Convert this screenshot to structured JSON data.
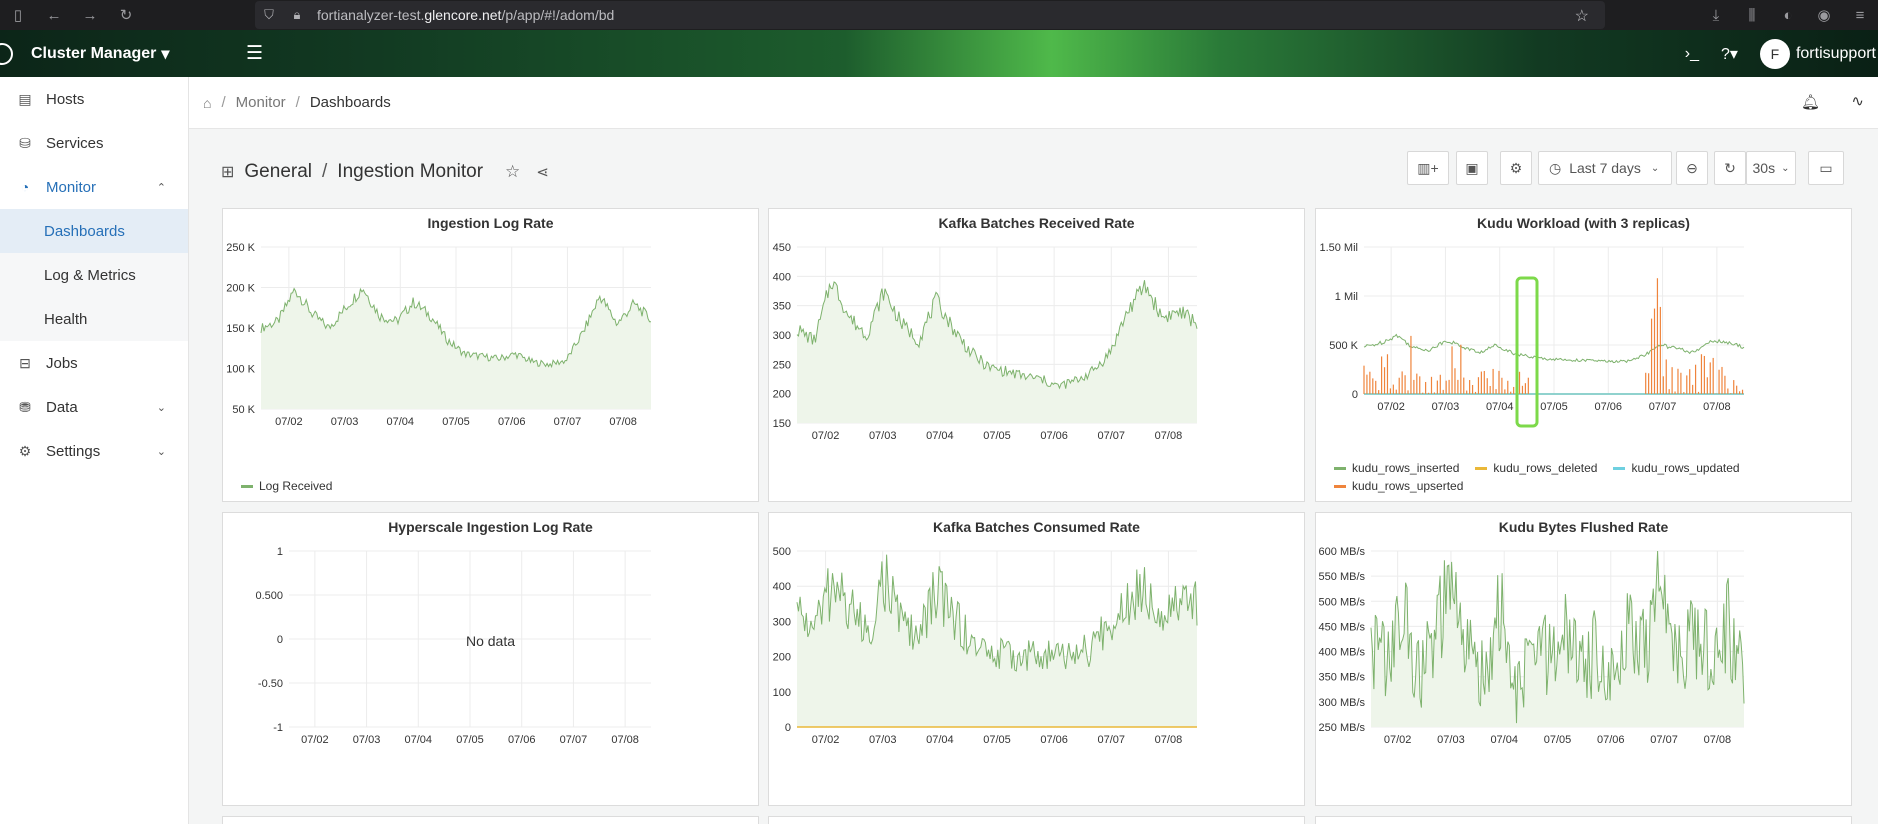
{
  "browser": {
    "url_prefix": "fortianalyzer-test.",
    "url_domain": "glencore.net",
    "url_path": "/p/app/#!/adom/bd"
  },
  "app": {
    "brand": "Cluster Manager",
    "user_initial": "F",
    "username": "fortisupport"
  },
  "sidebar": {
    "items": [
      {
        "label": "Hosts",
        "icon": "server-icon"
      },
      {
        "label": "Services",
        "icon": "services-icon"
      },
      {
        "label": "Monitor",
        "icon": "monitor-icon"
      },
      {
        "label": "Jobs",
        "icon": "jobs-icon"
      },
      {
        "label": "Data",
        "icon": "database-icon"
      },
      {
        "label": "Settings",
        "icon": "gear-icon"
      }
    ],
    "monitor_sub": [
      "Dashboards",
      "Log & Metrics",
      "Health"
    ]
  },
  "breadcrumb": {
    "items": [
      "Monitor",
      "Dashboards"
    ]
  },
  "dashboard": {
    "folder": "General",
    "name": "Ingestion Monitor",
    "time_range": "Last 7 days",
    "refresh": "30s"
  },
  "colors": {
    "green": "#7eb26d",
    "orange": "#ef843c",
    "yellow": "#eab839",
    "cyan": "#6ed0e0",
    "highlight": "#7dd94a"
  },
  "chart_data": [
    {
      "type": "area",
      "title": "Ingestion Log Rate",
      "x": [
        "07/02",
        "07/03",
        "07/04",
        "07/05",
        "07/06",
        "07/07",
        "07/08"
      ],
      "y_ticks": [
        "250 K",
        "200 K",
        "150 K",
        "100 K",
        "50 K"
      ],
      "ylim": [
        50000,
        250000
      ],
      "series": [
        {
          "name": "Log Received",
          "values": [
            150000,
            158000,
            198000,
            168000,
            150000,
            175000,
            200000,
            165000,
            158000,
            182000,
            165000,
            135000,
            118000,
            115000,
            112000,
            118000,
            108000,
            105000,
            110000,
            145000,
            190000,
            155000,
            180000,
            160000
          ]
        }
      ]
    },
    {
      "type": "area",
      "title": "Kafka Batches Received Rate",
      "x": [
        "07/02",
        "07/03",
        "07/04",
        "07/05",
        "07/06",
        "07/07",
        "07/08"
      ],
      "y_ticks": [
        "450",
        "400",
        "350",
        "300",
        "250",
        "200",
        "150"
      ],
      "ylim": [
        150,
        450
      ],
      "series": [
        {
          "values": [
            310,
            290,
            395,
            330,
            300,
            375,
            320,
            290,
            360,
            310,
            270,
            245,
            238,
            230,
            225,
            212,
            222,
            238,
            270,
            340,
            385,
            330,
            340,
            320
          ]
        }
      ]
    },
    {
      "type": "line",
      "title": "Kudu Workload (with 3 replicas)",
      "x": [
        "07/02",
        "07/03",
        "07/04",
        "07/05",
        "07/06",
        "07/07",
        "07/08"
      ],
      "y_ticks": [
        "1.50 Mil",
        "1 Mil",
        "500 K",
        "0"
      ],
      "ylim": [
        0,
        1500000
      ],
      "series": [
        {
          "name": "kudu_rows_inserted",
          "values": [
            480000,
            520000,
            600000,
            470000,
            450000,
            550000,
            480000,
            420000,
            500000,
            420000,
            380000,
            360000,
            350000,
            345000,
            340000,
            330000,
            335000,
            400000,
            500000,
            460000,
            420000,
            550000,
            520000,
            480000
          ]
        },
        {
          "name": "kudu_rows_deleted",
          "values": [
            0,
            0,
            0,
            0,
            0,
            0,
            0,
            0,
            0,
            0,
            0,
            0,
            0,
            0,
            0,
            0,
            0,
            0,
            0,
            0,
            0,
            0,
            0,
            0
          ]
        },
        {
          "name": "kudu_rows_updated",
          "values": [
            0,
            0,
            0,
            0,
            0,
            0,
            0,
            0,
            0,
            0,
            0,
            0,
            0,
            0,
            0,
            0,
            0,
            0,
            0,
            0,
            0,
            0,
            0,
            0
          ]
        },
        {
          "name": "kudu_rows_upserted",
          "values": [
            300000,
            450000,
            600000,
            350000,
            200000,
            550000,
            420000,
            300000,
            500000,
            250000,
            0,
            0,
            0,
            0,
            0,
            0,
            0,
            1250000,
            400000,
            300000,
            500000,
            400000,
            200000,
            150000
          ]
        }
      ]
    },
    {
      "type": "line",
      "title": "Hyperscale Ingestion Log Rate",
      "x": [
        "07/02",
        "07/03",
        "07/04",
        "07/05",
        "07/06",
        "07/07",
        "07/08"
      ],
      "y_ticks": [
        "1",
        "0.500",
        "0",
        "-0.50",
        "-1"
      ],
      "ylim": [
        -1,
        1
      ],
      "no_data": "No data"
    },
    {
      "type": "area",
      "title": "Kafka Batches Consumed Rate",
      "x": [
        "07/02",
        "07/03",
        "07/04",
        "07/05",
        "07/06",
        "07/07",
        "07/08"
      ],
      "y_ticks": [
        "500",
        "400",
        "300",
        "200",
        "100",
        "0"
      ],
      "ylim": [
        0,
        500
      ],
      "series": [
        {
          "values": [
            330,
            280,
            400,
            350,
            260,
            420,
            300,
            250,
            390,
            320,
            240,
            210,
            205,
            200,
            205,
            200,
            210,
            220,
            300,
            360,
            410,
            330,
            380,
            340
          ]
        },
        {
          "values": [
            0,
            0,
            0,
            0,
            0,
            0,
            0,
            0,
            0,
            0,
            0,
            0,
            0,
            0,
            0,
            0,
            0,
            0,
            0,
            0,
            0,
            0,
            0,
            0
          ]
        }
      ]
    },
    {
      "type": "area",
      "title": "Kudu Bytes Flushed Rate",
      "x": [
        "07/02",
        "07/03",
        "07/04",
        "07/05",
        "07/06",
        "07/07",
        "07/08"
      ],
      "y_ticks": [
        "600 MB/s",
        "550 MB/s",
        "500 MB/s",
        "450 MB/s",
        "400 MB/s",
        "350 MB/s",
        "300 MB/s",
        "250 MB/s"
      ],
      "ylim": [
        250,
        600
      ],
      "series": [
        {
          "values": [
            420,
            380,
            470,
            350,
            430,
            520,
            390,
            360,
            480,
            300,
            420,
            380,
            440,
            360,
            410,
            350,
            460,
            390,
            560,
            400,
            440,
            380,
            460,
            350
          ]
        }
      ]
    }
  ]
}
